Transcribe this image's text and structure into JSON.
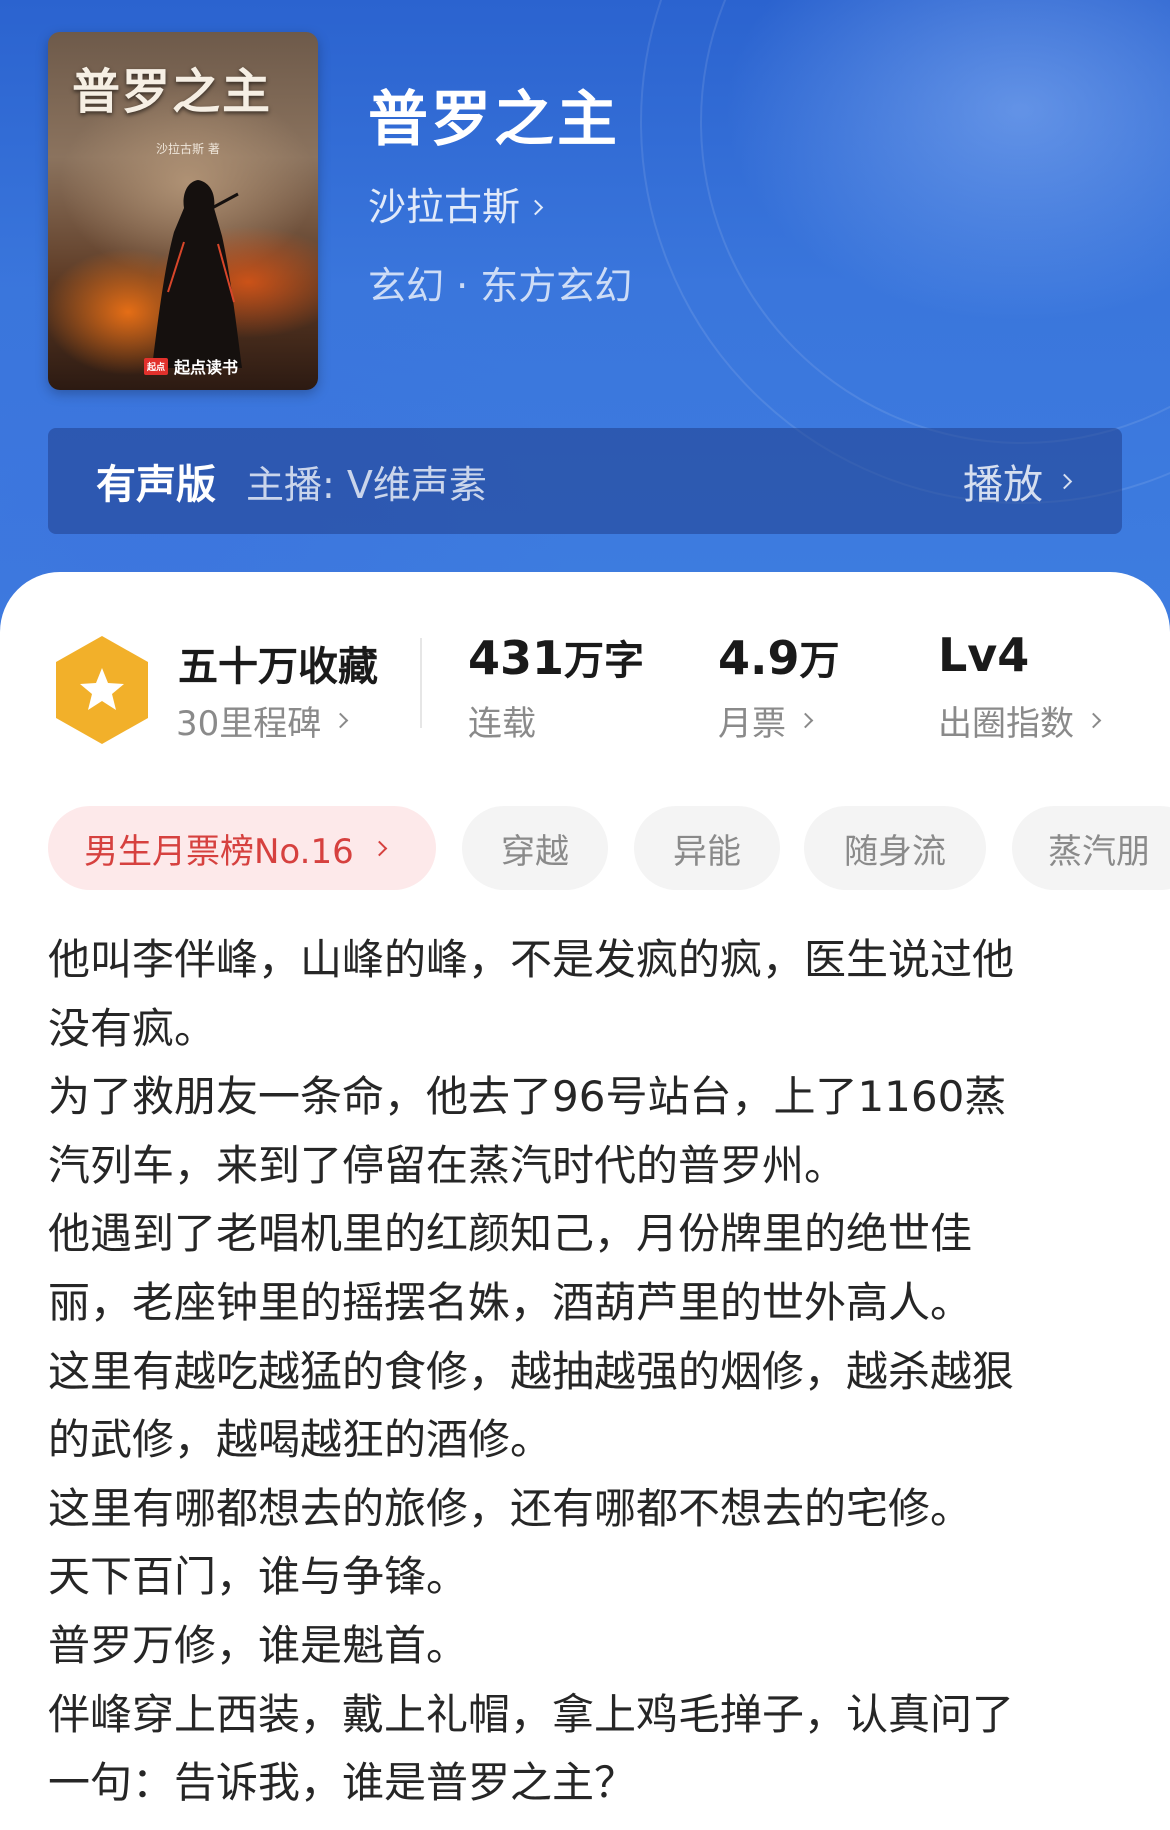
{
  "header": {
    "cover": {
      "title": "普罗之主",
      "author": "沙拉古斯 著",
      "publisher_mark": "起点",
      "publisher": "起点读书"
    },
    "title": "普罗之主",
    "author": "沙拉古斯",
    "genre": "玄幻 · 东方玄幻"
  },
  "audio": {
    "label": "有声版",
    "host": "主播: V维声素",
    "play": "播放"
  },
  "stats": {
    "favorites": {
      "main": "五十万收藏",
      "sub": "30里程碑",
      "icon": "star-hexagon-icon",
      "color": "#f2b02a"
    },
    "words": {
      "num": "431",
      "unit": "万字",
      "sub": "连载"
    },
    "tickets": {
      "num": "4.9",
      "unit": "万",
      "sub": "月票"
    },
    "level": {
      "main": "Lv4",
      "sub": "出圈指数"
    }
  },
  "tags": [
    {
      "label": "男生月票榜No.16"
    },
    {
      "label": "穿越"
    },
    {
      "label": "异能"
    },
    {
      "label": "随身流"
    },
    {
      "label": "蒸汽朋"
    }
  ],
  "synopsis": [
    "他叫李伴峰，山峰的峰，不是发疯的疯，医生说过他",
    "没有疯。",
    "为了救朋友一条命，他去了96号站台，上了1160蒸",
    "汽列车，来到了停留在蒸汽时代的普罗州。",
    "他遇到了老唱机里的红颜知己，月份牌里的绝世佳",
    "丽，老座钟里的摇摆名姝，酒葫芦里的世外高人。",
    "这里有越吃越猛的食修，越抽越强的烟修，越杀越狠",
    "的武修，越喝越狂的酒修。",
    "这里有哪都想去的旅修，还有哪都不想去的宅修。",
    "天下百门，谁与争锋。",
    "普罗万修，谁是魁首。",
    "伴峰穿上西装，戴上礼帽，拿上鸡毛掸子，认真问了",
    "一句：告诉我，谁是普罗之主？"
  ]
}
